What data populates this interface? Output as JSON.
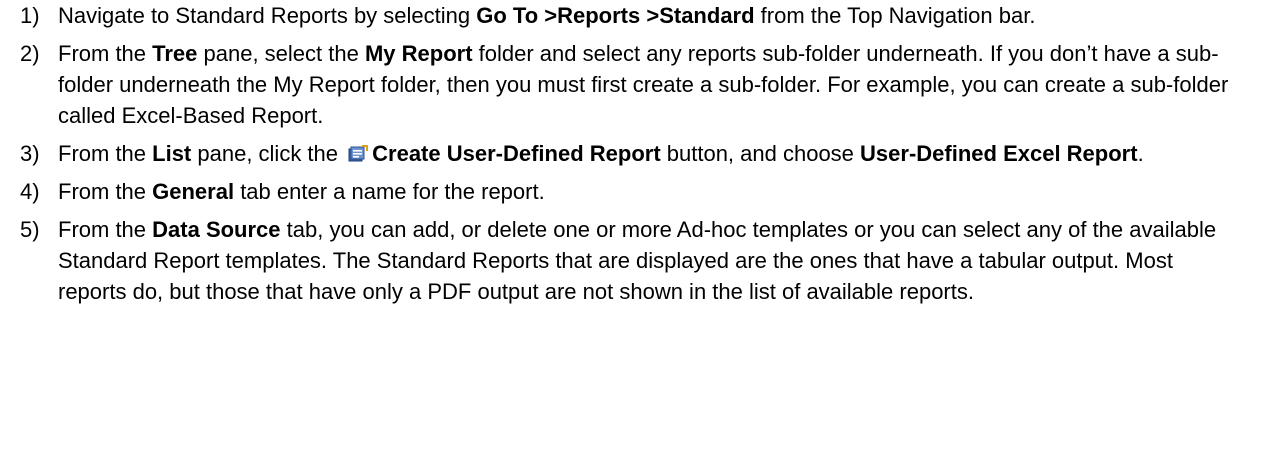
{
  "steps": [
    {
      "num": "1)",
      "t1": "Navigate to Standard Reports by selecting ",
      "b1": "Go To >Reports >Standard",
      "t2": " from the Top Navigation bar."
    },
    {
      "num": "2)",
      "t1": "From the ",
      "b1": "Tree",
      "t2": " pane, select the ",
      "b2": "My Report",
      "t3": " folder and select any reports sub-folder underneath. If you don’t have a sub-folder underneath the My Report folder, then you must first create a sub-folder. For example, you can create a sub-folder called Excel-Based Report."
    },
    {
      "num": "3)",
      "t1": "From the ",
      "b1": "List",
      "t2": " pane, click the ",
      "icon": "report-icon",
      "b2": "Create User-Defined Report",
      "t3": " button, and choose ",
      "b3": "User-Defined Excel Report",
      "t4": "."
    },
    {
      "num": "4)",
      "t1": "From the ",
      "b1": "General",
      "t2": " tab enter a name for the report."
    },
    {
      "num": "5)",
      "t1": "From the ",
      "b1": "Data Source",
      "t2": " tab, you can add, or delete one or more Ad-hoc templates or you can select any of the available Standard Report templates. The Standard Reports that are displayed are the ones that have a tabular output. Most reports do, but those that have only a PDF output are not shown in the list of available reports."
    }
  ]
}
